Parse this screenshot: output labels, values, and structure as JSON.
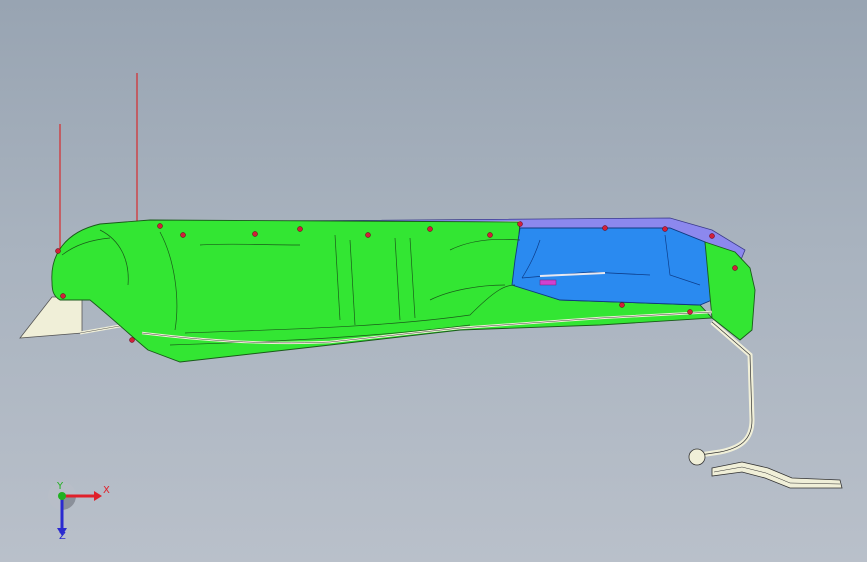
{
  "viewport": {
    "background_top": "#98a4b2",
    "background_bottom": "#b9c0ca"
  },
  "model": {
    "body_color": "#33e633",
    "shell_color": "#2a8af0",
    "flange_color": "#8c88ee",
    "bracket_color": "#f0efd8",
    "guide_line_color": "#e01010",
    "marker_color": "#d0203a"
  },
  "triad": {
    "x_label": "X",
    "y_label": "Y",
    "z_label": "Z",
    "x_color": "#e0202a",
    "y_color": "#20b020",
    "z_color": "#2a2ad0"
  }
}
